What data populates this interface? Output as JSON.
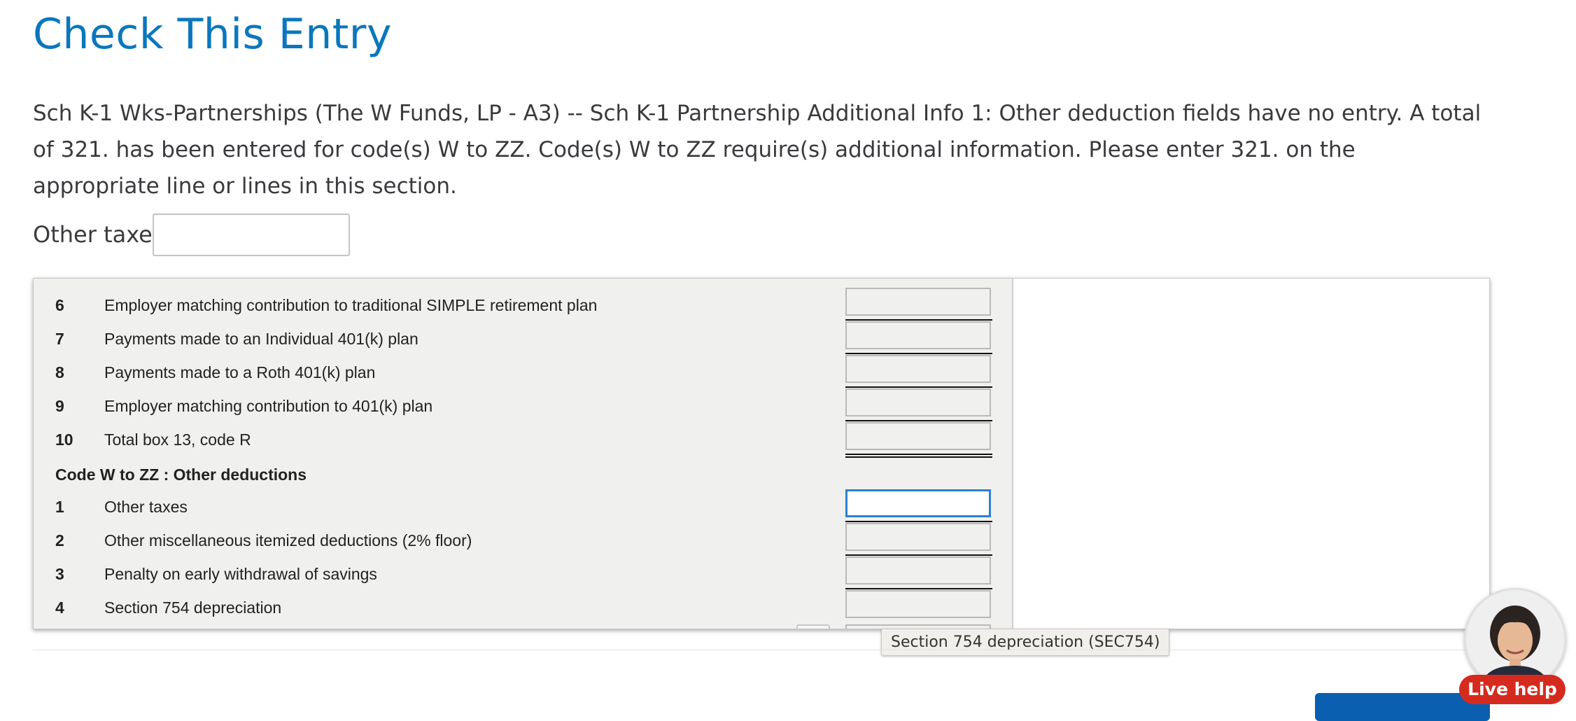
{
  "page": {
    "title": "Check This Entry",
    "message": "Sch K-1 Wks-Partnerships (The W Funds, LP - A3) -- Sch K-1 Partnership Additional Info 1: Other deduction fields have no entry. A total of 321. has been entered for code(s) W to ZZ. Code(s) W to ZZ require(s) additional information. Please enter 321. on the appropriate line or lines in this section.",
    "field": {
      "label": "Other taxes",
      "value": ""
    }
  },
  "worksheet": {
    "rows": [
      {
        "num": "6",
        "label": "Employer matching contribution to traditional SIMPLE retirement plan",
        "value": ""
      },
      {
        "num": "7",
        "label": "Payments made to an Individual 401(k) plan",
        "value": ""
      },
      {
        "num": "8",
        "label": "Payments made to a Roth 401(k) plan",
        "value": ""
      },
      {
        "num": "9",
        "label": "Employer matching contribution to 401(k) plan",
        "value": ""
      },
      {
        "num": "10",
        "label": "Total box 13, code R",
        "value": ""
      }
    ],
    "section_title": "Code W to ZZ : Other deductions",
    "section_rows": [
      {
        "num": "1",
        "label": "Other taxes",
        "value": ""
      },
      {
        "num": "2",
        "label": "Other miscellaneous itemized deductions (2% floor)",
        "value": ""
      },
      {
        "num": "3",
        "label": "Penalty on early withdrawal of savings",
        "value": ""
      },
      {
        "num": "4",
        "label": "Section 754 depreciation",
        "value": ""
      }
    ]
  },
  "tooltip": "Section 754 depreciation (SEC754)",
  "live_help": {
    "label": "Live help"
  },
  "colors": {
    "title": "#0a77bd",
    "live_help": "#d52b1e",
    "active_border": "#2f7fd1"
  }
}
